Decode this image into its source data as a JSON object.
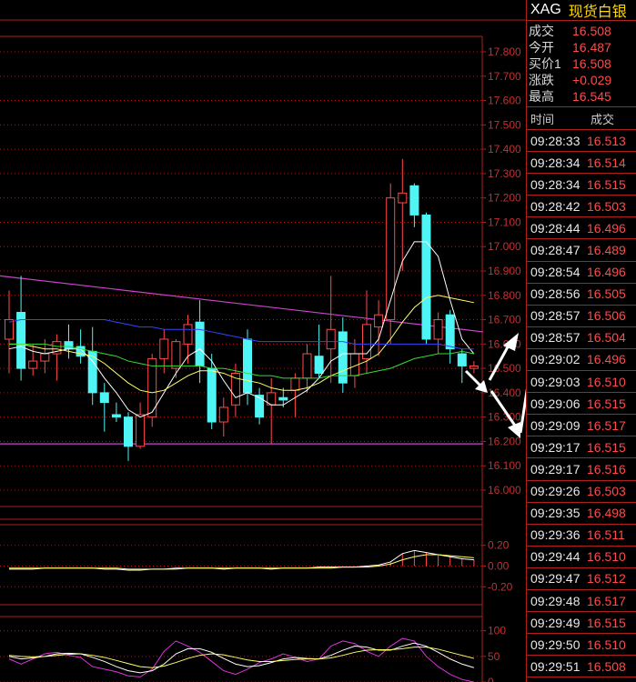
{
  "header": {
    "symbol": "XAG",
    "name": "现货白银"
  },
  "quote": [
    {
      "label": "成交",
      "value": "16.508"
    },
    {
      "label": "今开",
      "value": "16.487"
    },
    {
      "label": "买价1",
      "value": "16.508"
    },
    {
      "label": "涨跌",
      "value": "+0.029"
    },
    {
      "label": "最高",
      "value": "16.545"
    }
  ],
  "ticks_header": {
    "time": "时间",
    "price": "成交"
  },
  "ticks": [
    {
      "time": "09:28:33",
      "price": "16.513"
    },
    {
      "time": "09:28:34",
      "price": "16.514"
    },
    {
      "time": "09:28:34",
      "price": "16.515"
    },
    {
      "time": "09:28:42",
      "price": "16.503"
    },
    {
      "time": "09:28:44",
      "price": "16.496"
    },
    {
      "time": "09:28:47",
      "price": "16.489"
    },
    {
      "time": "09:28:54",
      "price": "16.496"
    },
    {
      "time": "09:28:56",
      "price": "16.505"
    },
    {
      "time": "09:28:57",
      "price": "16.506"
    },
    {
      "time": "09:28:57",
      "price": "16.504"
    },
    {
      "time": "09:29:02",
      "price": "16.496"
    },
    {
      "time": "09:29:03",
      "price": "16.510"
    },
    {
      "time": "09:29:06",
      "price": "16.515"
    },
    {
      "time": "09:29:09",
      "price": "16.517"
    },
    {
      "time": "09:29:17",
      "price": "16.515"
    },
    {
      "time": "09:29:17",
      "price": "16.516"
    },
    {
      "time": "09:29:26",
      "price": "16.503"
    },
    {
      "time": "09:29:35",
      "price": "16.498"
    },
    {
      "time": "09:29:36",
      "price": "16.511"
    },
    {
      "time": "09:29:44",
      "price": "16.510"
    },
    {
      "time": "09:29:47",
      "price": "16.512"
    },
    {
      "time": "09:29:48",
      "price": "16.517"
    },
    {
      "time": "09:29:49",
      "price": "16.515"
    },
    {
      "time": "09:29:50",
      "price": "16.510"
    },
    {
      "time": "09:29:51",
      "price": "16.508"
    }
  ],
  "colors": {
    "up": "#ff4a4a",
    "down": "#4ff5f5",
    "grid": "#b0201c",
    "axis_text": "#c33030"
  },
  "chart_data": [
    {
      "type": "candlestick",
      "y_ticks": [
        "17.800",
        "17.700",
        "17.600",
        "17.500",
        "17.400",
        "17.300",
        "17.200",
        "17.100",
        "17.000",
        "16.900",
        "16.800",
        "16.700",
        "16.600",
        "16.500",
        "16.400",
        "16.300",
        "16.200",
        "16.100",
        "16.000"
      ],
      "ylim": [
        16.0,
        17.8
      ],
      "candles": [
        {
          "o": 16.62,
          "h": 16.82,
          "l": 16.48,
          "c": 16.7
        },
        {
          "o": 16.73,
          "h": 16.88,
          "l": 16.45,
          "c": 16.5
        },
        {
          "o": 16.5,
          "h": 16.6,
          "l": 16.47,
          "c": 16.53
        },
        {
          "o": 16.53,
          "h": 16.62,
          "l": 16.48,
          "c": 16.56
        },
        {
          "o": 16.56,
          "h": 16.64,
          "l": 16.45,
          "c": 16.61
        },
        {
          "o": 16.61,
          "h": 16.68,
          "l": 16.54,
          "c": 16.58
        },
        {
          "o": 16.59,
          "h": 16.66,
          "l": 16.52,
          "c": 16.55
        },
        {
          "o": 16.57,
          "h": 16.67,
          "l": 16.35,
          "c": 16.4
        },
        {
          "o": 16.4,
          "h": 16.44,
          "l": 16.24,
          "c": 16.36
        },
        {
          "o": 16.31,
          "h": 16.36,
          "l": 16.28,
          "c": 16.3
        },
        {
          "o": 16.3,
          "h": 16.32,
          "l": 16.12,
          "c": 16.18
        },
        {
          "o": 16.18,
          "h": 16.36,
          "l": 16.17,
          "c": 16.31
        },
        {
          "o": 16.3,
          "h": 16.56,
          "l": 16.26,
          "c": 16.54
        },
        {
          "o": 16.54,
          "h": 16.66,
          "l": 16.48,
          "c": 16.62
        },
        {
          "o": 16.5,
          "h": 16.62,
          "l": 16.46,
          "c": 16.61
        },
        {
          "o": 16.6,
          "h": 16.72,
          "l": 16.52,
          "c": 16.68
        },
        {
          "o": 16.69,
          "h": 16.78,
          "l": 16.44,
          "c": 16.51
        },
        {
          "o": 16.5,
          "h": 16.56,
          "l": 16.25,
          "c": 16.28
        },
        {
          "o": 16.28,
          "h": 16.38,
          "l": 16.22,
          "c": 16.34
        },
        {
          "o": 16.35,
          "h": 16.52,
          "l": 16.3,
          "c": 16.48
        },
        {
          "o": 16.62,
          "h": 16.66,
          "l": 16.35,
          "c": 16.4
        },
        {
          "o": 16.39,
          "h": 16.42,
          "l": 16.27,
          "c": 16.3
        },
        {
          "o": 16.35,
          "h": 16.46,
          "l": 16.19,
          "c": 16.4
        },
        {
          "o": 16.38,
          "h": 16.42,
          "l": 16.34,
          "c": 16.37
        },
        {
          "o": 16.41,
          "h": 16.48,
          "l": 16.3,
          "c": 16.46
        },
        {
          "o": 16.46,
          "h": 16.6,
          "l": 16.4,
          "c": 16.56
        },
        {
          "o": 16.55,
          "h": 16.68,
          "l": 16.46,
          "c": 16.48
        },
        {
          "o": 16.58,
          "h": 16.88,
          "l": 16.44,
          "c": 16.66
        },
        {
          "o": 16.65,
          "h": 16.71,
          "l": 16.4,
          "c": 16.44
        },
        {
          "o": 16.47,
          "h": 16.62,
          "l": 16.42,
          "c": 16.56
        },
        {
          "o": 16.54,
          "h": 16.82,
          "l": 16.48,
          "c": 16.68
        },
        {
          "o": 16.67,
          "h": 16.78,
          "l": 16.55,
          "c": 16.72
        },
        {
          "o": 16.7,
          "h": 17.26,
          "l": 16.6,
          "c": 17.2
        },
        {
          "o": 17.18,
          "h": 17.36,
          "l": 16.9,
          "c": 17.22
        },
        {
          "o": 17.25,
          "h": 17.26,
          "l": 17.08,
          "c": 17.13
        },
        {
          "o": 17.13,
          "h": 17.14,
          "l": 16.6,
          "c": 16.62
        },
        {
          "o": 16.62,
          "h": 16.73,
          "l": 16.56,
          "c": 16.7
        },
        {
          "o": 16.72,
          "h": 16.74,
          "l": 16.52,
          "c": 16.58
        },
        {
          "o": 16.56,
          "h": 16.58,
          "l": 16.44,
          "c": 16.51
        },
        {
          "o": 16.5,
          "h": 16.53,
          "l": 16.48,
          "c": 16.51
        }
      ],
      "ma_lines": [
        {
          "color": "#ffffff",
          "values": [
            16.58,
            16.59,
            16.57,
            16.56,
            16.57,
            16.58,
            16.58,
            16.53,
            16.46,
            16.4,
            16.33,
            16.3,
            16.32,
            16.4,
            16.48,
            16.55,
            16.58,
            16.53,
            16.45,
            16.38,
            16.4,
            16.38,
            16.35,
            16.35,
            16.38,
            16.41,
            16.46,
            16.53,
            16.56,
            16.56,
            16.56,
            16.62,
            16.78,
            16.94,
            17.02,
            17.02,
            16.96,
            16.78,
            16.62,
            16.56
          ]
        },
        {
          "color": "#ffff66",
          "values": [
            16.6,
            16.6,
            16.59,
            16.58,
            16.58,
            16.57,
            16.56,
            16.55,
            16.52,
            16.48,
            16.44,
            16.41,
            16.4,
            16.41,
            16.44,
            16.47,
            16.49,
            16.49,
            16.48,
            16.46,
            16.45,
            16.44,
            16.42,
            16.41,
            16.41,
            16.42,
            16.44,
            16.47,
            16.49,
            16.51,
            16.53,
            16.56,
            16.62,
            16.69,
            16.75,
            16.79,
            16.8,
            16.79,
            16.78,
            16.77
          ]
        },
        {
          "color": "#33dd33",
          "values": [
            16.6,
            16.6,
            16.6,
            16.6,
            16.59,
            16.59,
            16.58,
            16.57,
            16.56,
            16.55,
            16.53,
            16.52,
            16.51,
            16.51,
            16.51,
            16.51,
            16.51,
            16.5,
            16.5,
            16.49,
            16.48,
            16.47,
            16.47,
            16.46,
            16.46,
            16.46,
            16.46,
            16.47,
            16.47,
            16.47,
            16.48,
            16.49,
            16.5,
            16.52,
            16.54,
            16.55,
            16.56,
            16.56,
            16.57,
            16.56
          ]
        },
        {
          "color": "#3344ff",
          "values": [
            16.69,
            16.7,
            16.7,
            16.7,
            16.7,
            16.7,
            16.7,
            16.7,
            16.7,
            16.69,
            16.68,
            16.67,
            16.67,
            16.66,
            16.66,
            16.66,
            16.66,
            16.65,
            16.64,
            16.63,
            16.62,
            16.61,
            16.61,
            16.61,
            16.61,
            16.61,
            16.61,
            16.61,
            16.61,
            16.6,
            16.6,
            16.6,
            16.6,
            16.6,
            16.6,
            16.6,
            16.6,
            16.59,
            16.58,
            16.58
          ]
        }
      ],
      "trendlines": [
        {
          "color": "#cc44cc",
          "from": [
            0,
            16.88
          ],
          "to": [
            39,
            16.65
          ]
        },
        {
          "color": "#cc44cc",
          "from": [
            0,
            16.19
          ],
          "to": [
            39,
            16.19
          ]
        }
      ]
    },
    {
      "type": "line",
      "y_ticks": [
        "0.20",
        "0.00",
        "-0.20"
      ],
      "ylim": [
        -0.25,
        0.25
      ],
      "series": [
        {
          "color": "#ffffff",
          "values": [
            -0.03,
            -0.03,
            -0.03,
            -0.02,
            -0.02,
            -0.02,
            -0.02,
            -0.02,
            -0.03,
            -0.03,
            -0.04,
            -0.04,
            -0.03,
            -0.03,
            -0.02,
            -0.02,
            -0.02,
            -0.02,
            -0.03,
            -0.02,
            -0.02,
            -0.02,
            -0.03,
            -0.02,
            -0.02,
            -0.02,
            -0.01,
            -0.01,
            -0.01,
            -0.01,
            0.0,
            0.01,
            0.04,
            0.12,
            0.15,
            0.13,
            0.11,
            0.09,
            0.07,
            0.06
          ]
        },
        {
          "color": "#ffff66",
          "values": [
            -0.02,
            -0.02,
            -0.02,
            -0.02,
            -0.02,
            -0.02,
            -0.02,
            -0.02,
            -0.02,
            -0.02,
            -0.03,
            -0.03,
            -0.03,
            -0.03,
            -0.03,
            -0.02,
            -0.02,
            -0.02,
            -0.02,
            -0.02,
            -0.02,
            -0.02,
            -0.02,
            -0.02,
            -0.02,
            -0.02,
            -0.02,
            -0.02,
            -0.01,
            -0.01,
            -0.01,
            0.0,
            0.02,
            0.06,
            0.09,
            0.11,
            0.11,
            0.1,
            0.09,
            0.08
          ]
        }
      ]
    },
    {
      "type": "line",
      "y_ticks": [
        "100",
        "50",
        "0"
      ],
      "ylim": [
        0,
        110
      ],
      "series": [
        {
          "color": "#dd33dd",
          "values": [
            45,
            35,
            45,
            55,
            58,
            52,
            48,
            30,
            25,
            20,
            12,
            10,
            25,
            60,
            80,
            70,
            58,
            40,
            22,
            15,
            25,
            38,
            45,
            55,
            48,
            40,
            45,
            70,
            80,
            75,
            60,
            50,
            70,
            85,
            80,
            50,
            30,
            15,
            5,
            0
          ]
        },
        {
          "color": "#ffffff",
          "values": [
            50,
            45,
            47,
            50,
            55,
            56,
            55,
            48,
            40,
            30,
            22,
            18,
            22,
            35,
            55,
            65,
            65,
            58,
            46,
            35,
            30,
            32,
            38,
            45,
            48,
            46,
            45,
            52,
            62,
            70,
            68,
            62,
            62,
            70,
            76,
            70,
            58,
            45,
            35,
            28
          ]
        },
        {
          "color": "#ffff66",
          "values": [
            52,
            50,
            49,
            50,
            52,
            54,
            55,
            52,
            48,
            42,
            36,
            30,
            28,
            31,
            38,
            46,
            52,
            55,
            53,
            48,
            43,
            40,
            40,
            42,
            44,
            45,
            45,
            47,
            52,
            58,
            62,
            63,
            63,
            65,
            68,
            68,
            64,
            58,
            52,
            46
          ]
        }
      ]
    }
  ]
}
